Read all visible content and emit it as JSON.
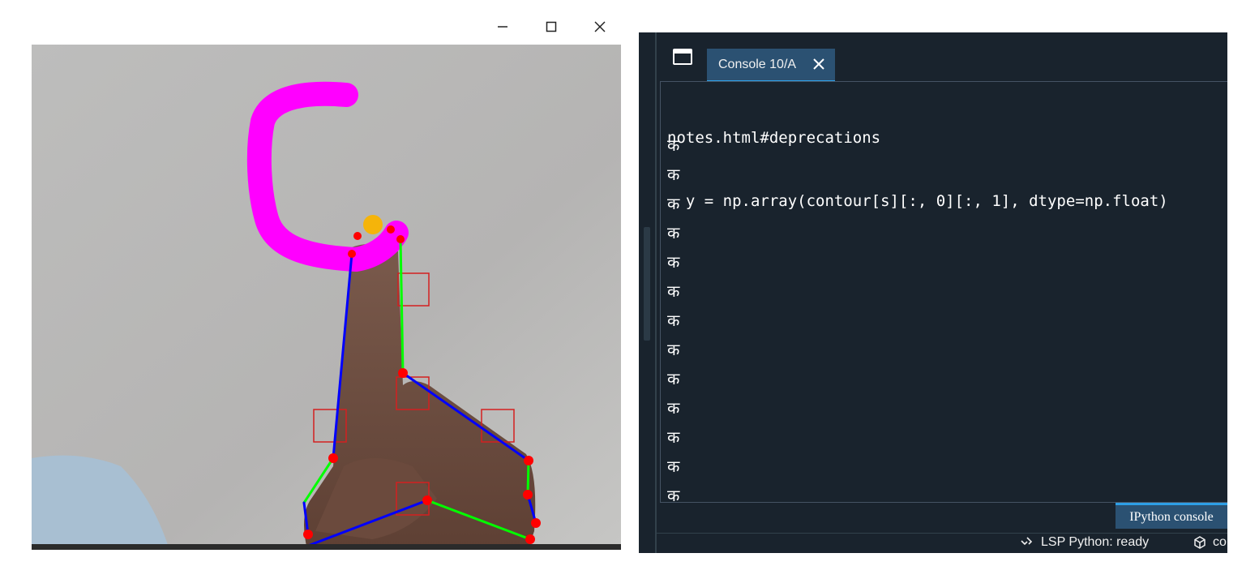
{
  "camera_window": {
    "controls": {
      "minimize_icon": "minimize-icon",
      "maximize_icon": "maximize-icon",
      "close_icon": "close-icon"
    },
    "colors": {
      "drawing_stroke": "#ff00ff",
      "fingertip_marker": "#f5b40a",
      "landmark_point": "#ff0000",
      "skeleton_blue": "#0000ff",
      "skeleton_green": "#00ff00",
      "bounding_box": "#d42020"
    }
  },
  "console": {
    "tab": {
      "label": "Console 10/A",
      "close_icon": "close-icon"
    },
    "lines": [
      "notes.html#deprecations",
      "  y = np.array(contour[s][:, 0][:, 1], dtype=np.float)"
    ],
    "output": [
      "क",
      "क",
      "क",
      "क",
      "क",
      "क",
      "क",
      "क",
      "क",
      "क",
      "क",
      "क",
      "क"
    ],
    "bottom_tab": {
      "label": "IPython console"
    },
    "status": {
      "lsp_label": "LSP Python: ready",
      "extra_label": "co"
    },
    "colors": {
      "background": "#19232d",
      "tab_active": "#2b5172",
      "tab_accent": "#2e9fe6",
      "text": "#ffffff"
    }
  }
}
